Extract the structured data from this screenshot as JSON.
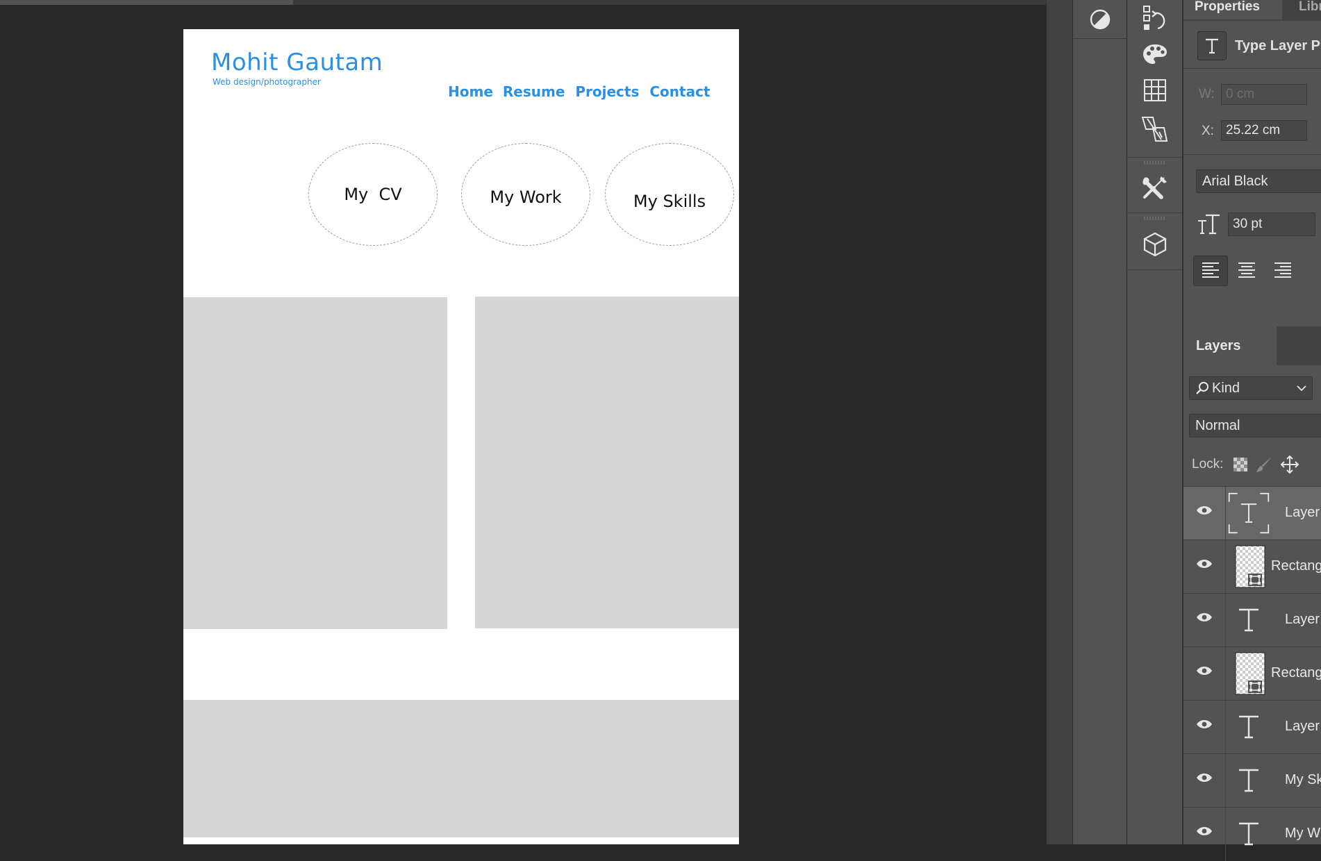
{
  "document": {
    "brand": "Mohit Gautam",
    "tagline": "Web design/photographer",
    "nav": [
      "Home",
      "Resume",
      "Projects",
      "Contact"
    ],
    "bubbles": [
      "My  CV",
      "My Work",
      "My Skills"
    ]
  },
  "properties": {
    "tabs": [
      "Properties",
      "Libr"
    ],
    "type_layer_label": "Type Layer P",
    "w_label": "W:",
    "w_value": "0 cm",
    "x_label": "X:",
    "x_value": "25.22 cm",
    "font_family": "Arial Black",
    "font_size": "30 pt"
  },
  "layers": {
    "tab": "Layers",
    "filter": "Kind",
    "blend_mode": "Normal",
    "lock_label": "Lock:",
    "items": [
      {
        "name": "Layer",
        "kind": "text",
        "selected": true
      },
      {
        "name": "Rectang",
        "kind": "shape",
        "selected": false
      },
      {
        "name": "Layer",
        "kind": "text",
        "selected": false
      },
      {
        "name": "Rectang",
        "kind": "shape",
        "selected": false
      },
      {
        "name": "Layer",
        "kind": "text",
        "selected": false
      },
      {
        "name": "My Sk",
        "kind": "text",
        "selected": false
      },
      {
        "name": "My W",
        "kind": "text",
        "selected": false
      }
    ]
  },
  "colors": {
    "brand_blue": "#2b8fe6",
    "panel_bg": "#535353",
    "canvas_bg": "#282828"
  }
}
